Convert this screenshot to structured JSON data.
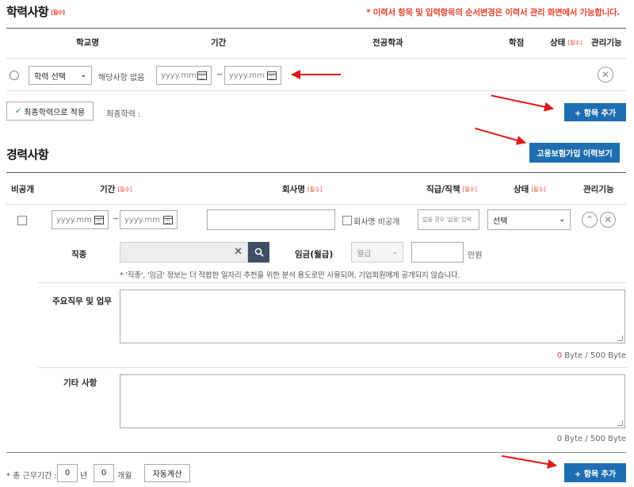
{
  "education": {
    "title": "학력사항",
    "required": "[필수]",
    "note": "* 이력서 항목 및 입력항목의 순서변경은 이력서 관리 화면에서 가능합니다.",
    "headers": {
      "school": "학교명",
      "period": "기간",
      "major": "전공학과",
      "gpa": "학점",
      "status": "상태",
      "manage": "관리기능"
    },
    "row": {
      "level_select": "학력 선택",
      "no_entry_label": "해당사항 없음",
      "date_placeholder": "yyyy.mm",
      "tilde": "~"
    },
    "apply_final_button": "최종학력으로 적용",
    "final_label": "최종학력 :",
    "add_button": "+ 항목 추가"
  },
  "career": {
    "title": "경력사항",
    "insurance_button": "고용보험가입 이력보기",
    "headers": {
      "private": "비공개",
      "period": "기간",
      "company": "회사명",
      "position": "직급/직책",
      "status": "상태",
      "manage": "관리기능"
    },
    "required": "[필수]",
    "row": {
      "date_placeholder": "yyyy.mm",
      "tilde": "~",
      "hide_company_label": "회사명 비공개",
      "position_placeholder": "없을 경우 '없음' 입력",
      "status_select": "선택"
    },
    "job_label": "직종",
    "salary_label": "임금(월급)",
    "salary_select": "월급",
    "salary_unit": "만원",
    "privacy_hint": "* '직종', '임금' 정보는 더 적합한 일자리 추천을 위한 분석 용도로만 사용되며, 기업회원에게 공개되지 않습니다.",
    "duties_label": "주요직무 및 업무",
    "bytes_count": "0",
    "bytes_suffix": " Byte / 500 Byte",
    "other_label": "기타 사항",
    "other_bytes": "0 Byte / 500 Byte",
    "total_label": "* 총 근무기간 :",
    "years_value": "0",
    "years_unit": "년",
    "months_value": "0",
    "months_unit": "개월",
    "auto_calc_button": "자동계산",
    "add_button": "+ 항목 추가"
  },
  "colors": {
    "accent_blue": "#1f6eb2",
    "required_red": "#e8432f",
    "annotation_arrow": "#e0191b"
  }
}
